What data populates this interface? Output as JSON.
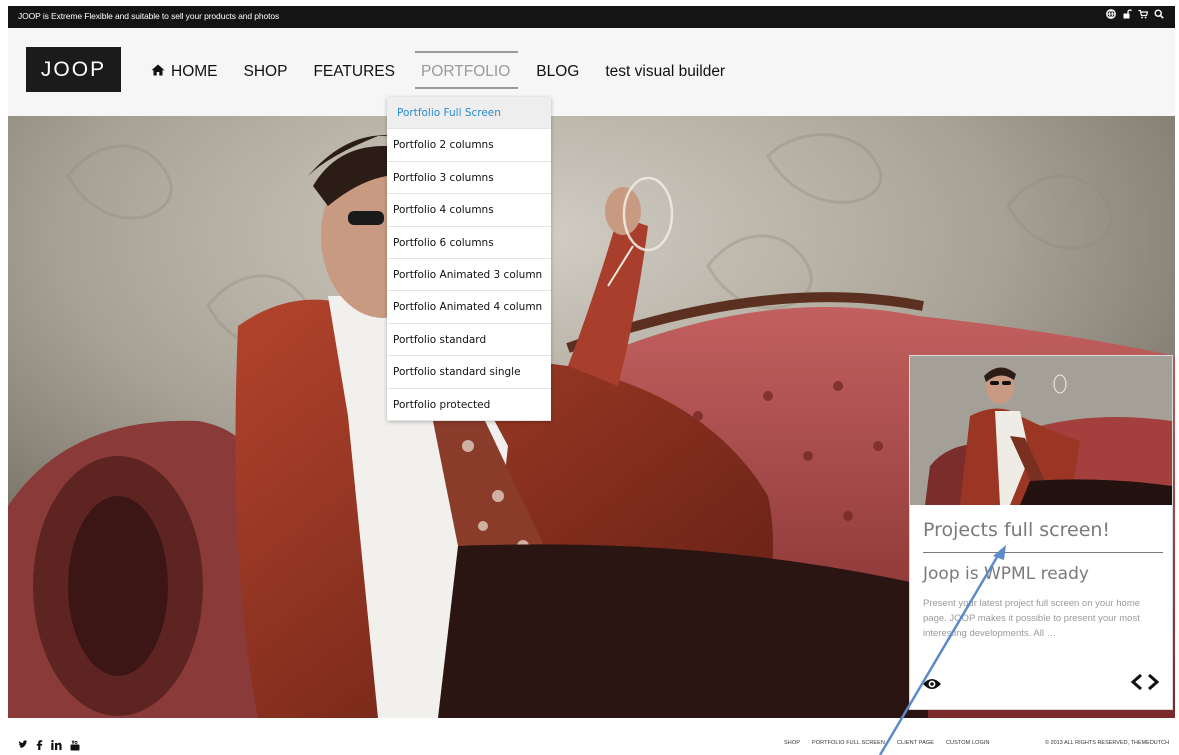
{
  "topbar": {
    "tagline": "JOOP is Extreme Flexible and suitable to sell your products and photos",
    "icons": [
      "globe-icon",
      "lock-icon",
      "cart-icon",
      "search-icon"
    ]
  },
  "header": {
    "logo": "JOOP",
    "nav": [
      {
        "label": "HOME",
        "icon": "home-icon"
      },
      {
        "label": "SHOP"
      },
      {
        "label": "FEATURES"
      },
      {
        "label": "PORTFOLIO",
        "active": true
      },
      {
        "label": "BLOG"
      },
      {
        "label": "test visual builder"
      }
    ]
  },
  "dropdown": {
    "items": [
      "Portfolio Full Screen",
      "Portfolio 2 columns",
      "Portfolio 3 columns",
      "Portfolio 4 columns",
      "Portfolio 6 columns",
      "Portfolio Animated 3 column",
      "Portfolio Animated 4 column",
      "Portfolio standard",
      "Portfolio standard single",
      "Portfolio protected"
    ]
  },
  "card": {
    "title": "Projects full screen!",
    "subtitle": "Joop is WPML ready",
    "description": "Present your latest project full screen on your home page. JOOP makes it possible to present your most interesting developments. All …",
    "view_icon": "eye-icon",
    "nav_arrows": "‹ ›"
  },
  "footer": {
    "social": [
      "twitter-icon",
      "facebook-icon",
      "linkedin-icon",
      "youtube-icon"
    ],
    "links": [
      "SHOP",
      "PORTFOLIO FULL SCREEN",
      "CLIENT PAGE",
      "CUSTOM LOGIN"
    ],
    "copyright": "© 2013 ALL RIGHTS RESERVED, THEMEDUTCH"
  },
  "colors": {
    "accent_blue": "#2a8bd0",
    "nav_active": "#9a9a9a",
    "topbar": "#141414",
    "annotation_line": "#5b8bc9"
  }
}
